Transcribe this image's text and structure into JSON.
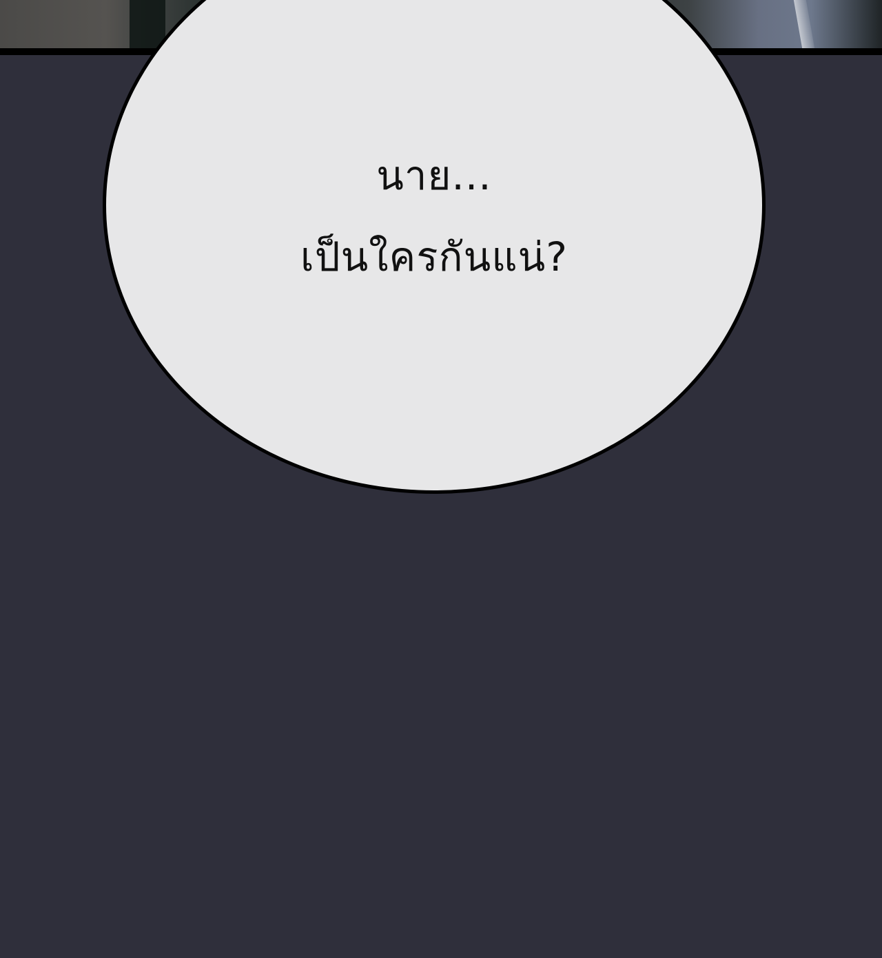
{
  "speech_bubble": {
    "lines": [
      "นาย...",
      "เป็นใครกันแน่?"
    ]
  },
  "colors": {
    "background": "#2f2f3b",
    "bubble_fill": "#e7e7e8",
    "bubble_outline": "#000000",
    "text": "#111111"
  }
}
